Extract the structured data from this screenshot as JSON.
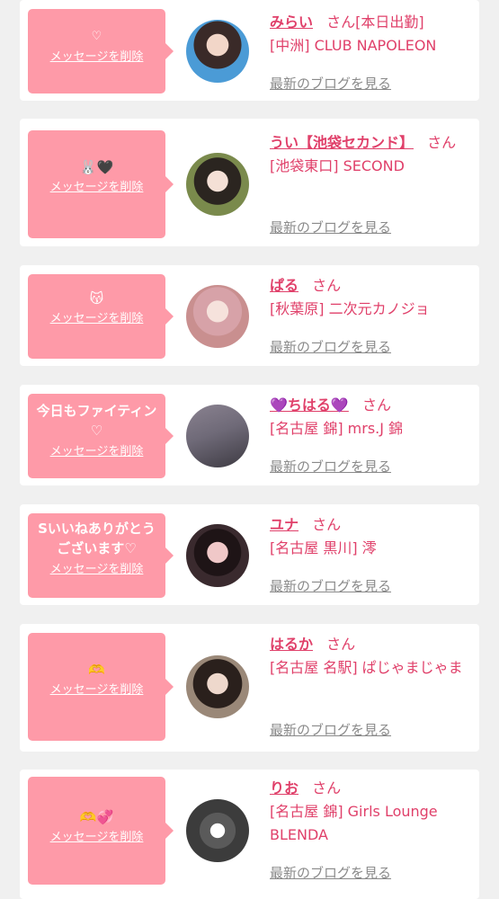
{
  "cards": [
    {
      "message": "♡",
      "delete_label": "メッセージを削除",
      "name": "みらい",
      "honorific": "さん",
      "shop_inline": "[本日出勤]",
      "shop": "[中洲] CLUB NAPOLEON",
      "blog_link": "最新のブログを見る",
      "avatar_color": "#4b9bd6"
    },
    {
      "message": "🐰🖤",
      "delete_label": "メッセージを削除",
      "name": "うい【池袋セカンド】",
      "honorific": "さん",
      "shop": "[池袋東口] SECOND",
      "blog_link": "最新のブログを見る",
      "avatar_color": "#7a8a4c"
    },
    {
      "message": "😽",
      "delete_label": "メッセージを削除",
      "name": "ぱる",
      "honorific": "さん",
      "shop": "[秋葉原] 二次元カノジョ",
      "blog_link": "最新のブログを見る",
      "avatar_color": "#c98f8f"
    },
    {
      "message": "今日もファイティン♡",
      "delete_label": "メッセージを削除",
      "name": "💜ちはる💜",
      "honorific": "さん",
      "shop": "[名古屋 錦] mrs.J 錦",
      "blog_link": "最新のブログを見る",
      "avatar_color": "#6f6a78"
    },
    {
      "message": "Sいいねありがとうございます♡",
      "delete_label": "メッセージを削除",
      "name": "ユナ",
      "honorific": "さん",
      "shop": "[名古屋 黒川] 澪",
      "blog_link": "最新のブログを見る",
      "avatar_color": "#3a2a2e"
    },
    {
      "message": "🫶",
      "delete_label": "メッセージを削除",
      "name": "はるか",
      "honorific": "さん",
      "shop": "[名古屋 名駅] ぱじゃまじゃま",
      "blog_link": "最新のブログを見る",
      "avatar_color": "#9a8878"
    },
    {
      "message": "🫶💞",
      "delete_label": "メッセージを削除",
      "name": "りお",
      "honorific": "さん",
      "shop": "[名古屋 錦] Girls Lounge BLENDA",
      "blog_link": "最新のブログを見る",
      "avatar_color": "#3c3c3c"
    }
  ]
}
